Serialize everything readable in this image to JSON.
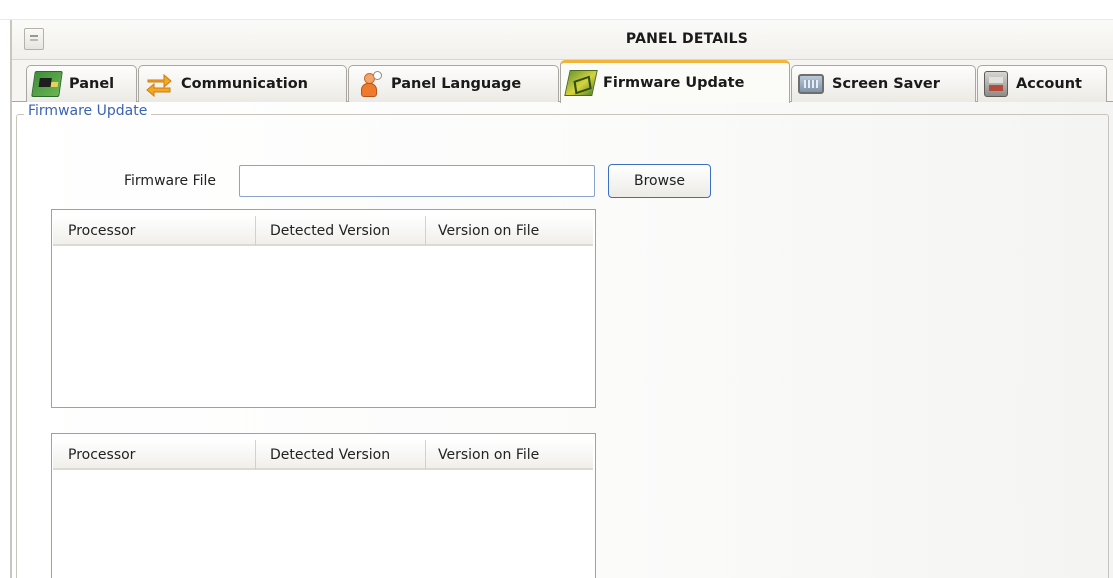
{
  "window": {
    "title": "PANEL DETAILS"
  },
  "tabs": [
    {
      "label": "Panel",
      "icon": "circuit-board-icon",
      "active": false
    },
    {
      "label": "Communication",
      "icon": "transfer-arrows-icon",
      "active": false
    },
    {
      "label": "Panel Language",
      "icon": "person-speech-icon",
      "active": false
    },
    {
      "label": "Firmware Update",
      "icon": "chip-update-icon",
      "active": true
    },
    {
      "label": "Screen Saver",
      "icon": "monitor-icon",
      "active": false
    },
    {
      "label": "Account",
      "icon": "account-device-icon",
      "active": false
    }
  ],
  "firmware_update": {
    "group_title": "Firmware Update",
    "file_label": "Firmware File",
    "file_value": "",
    "browse_label": "Browse",
    "tables": [
      {
        "columns": [
          "Processor",
          "Detected Version",
          "Version on File"
        ],
        "rows": []
      },
      {
        "columns": [
          "Processor",
          "Detected Version",
          "Version on File"
        ],
        "rows": []
      }
    ]
  },
  "colors": {
    "active_tab_accent": "#f2b53c",
    "group_title": "#3a63b5",
    "input_border": "#8aa5c8",
    "button_border": "#3c6fc4"
  }
}
